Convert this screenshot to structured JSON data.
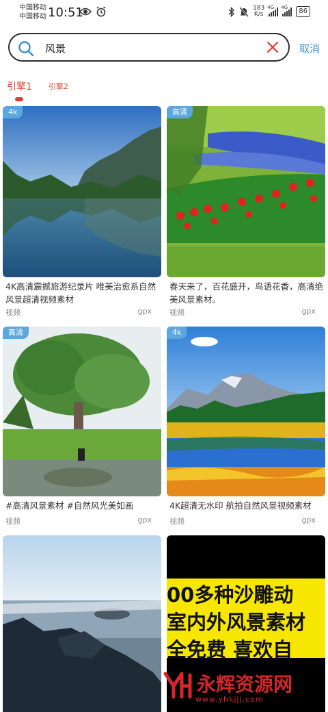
{
  "status": {
    "carrier1": "中国移动",
    "carrier2": "中国移动",
    "time": "10:51",
    "speed_value": "183",
    "speed_unit": "K/s",
    "net1": "4G",
    "net2": "4G",
    "battery": "86"
  },
  "search": {
    "query": "风景",
    "cancel_label": "取消"
  },
  "tabs": [
    {
      "label": "引擎1",
      "active": true
    },
    {
      "label": "引擎2",
      "active": false
    }
  ],
  "cards": [
    {
      "badge": "4k",
      "title": "4K高清震撼旅游纪录片 唯美治愈系自然风景超清视频素材",
      "type": "视频",
      "source": "gpx"
    },
    {
      "badge": "高清",
      "title": "春天来了，百花盛开，鸟语花香，高清绝美风景素材。",
      "type": "视频",
      "source": "gpx"
    },
    {
      "badge": "高清",
      "title": "#高清风景素材 #自然风光美如画",
      "type": "视频",
      "source": "gpx"
    },
    {
      "badge": "4k",
      "title": "4K超清无水印 航拍自然风景视频素材",
      "type": "视频",
      "source": "gpx"
    }
  ],
  "promo": {
    "line1": "00多种沙雕动",
    "line2": "室内外风景素材",
    "line3": "全免费 喜欢自"
  },
  "watermark": {
    "name": "永辉资源网",
    "url": "www.yhkjjj.com"
  },
  "colors": {
    "accent": "#3d8ccc",
    "tab_active": "#d84a35",
    "badge": "#5aa8de",
    "promo_bg": "#f6e600"
  }
}
